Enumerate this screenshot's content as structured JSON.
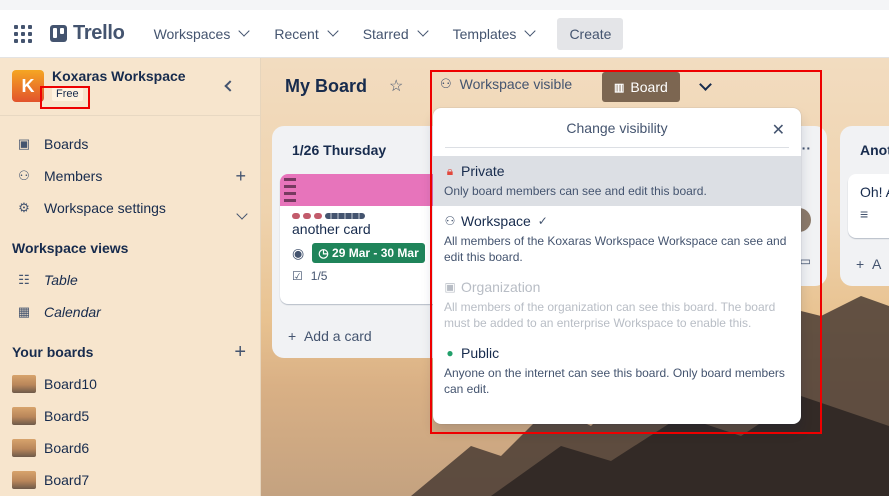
{
  "topbar": {
    "logo": "Trello",
    "nav": [
      {
        "label": "Workspaces"
      },
      {
        "label": "Recent"
      },
      {
        "label": "Starred"
      },
      {
        "label": "Templates"
      }
    ],
    "create_label": "Create"
  },
  "sidebar": {
    "workspace_initial": "K",
    "workspace_name": "Koxaras Workspace",
    "plan": "Free",
    "items": [
      {
        "label": "Boards"
      },
      {
        "label": "Members"
      },
      {
        "label": "Workspace settings"
      }
    ],
    "views_heading": "Workspace views",
    "views": [
      {
        "label": "Table"
      },
      {
        "label": "Calendar"
      }
    ],
    "boards_heading": "Your boards",
    "boards": [
      {
        "label": "Board10"
      },
      {
        "label": "Board5"
      },
      {
        "label": "Board6"
      },
      {
        "label": "Board7"
      }
    ]
  },
  "board": {
    "title": "My Board",
    "visibility_label": "Workspace visible",
    "view_label": "Board",
    "lists": [
      {
        "title": "1/26 Thursday",
        "card_title": "another card",
        "date_badge": "29 Mar - 30 Mar",
        "checklist": "1/5",
        "add_card": "Add a card"
      },
      {
        "title": "Anot",
        "card_title": "Oh! A",
        "add_card": "A"
      }
    ]
  },
  "popover": {
    "title": "Change visibility",
    "options": [
      {
        "label": "Private",
        "desc": "Only board members can see and edit this board."
      },
      {
        "label": "Workspace",
        "desc": "All members of the Koxaras Workspace Workspace can see and edit this board."
      },
      {
        "label": "Organization",
        "desc": "All members of the organization can see this board. The board must be added to an enterprise Workspace to enable this."
      },
      {
        "label": "Public",
        "desc": "Anyone on the internet can see this board. Only board members can edit."
      }
    ]
  },
  "colors": {
    "private": "#e2483d",
    "public": "#22a06b",
    "board_btn": "#7c6651",
    "date_badge": "#1f845a",
    "highlight": "#ee0000"
  }
}
